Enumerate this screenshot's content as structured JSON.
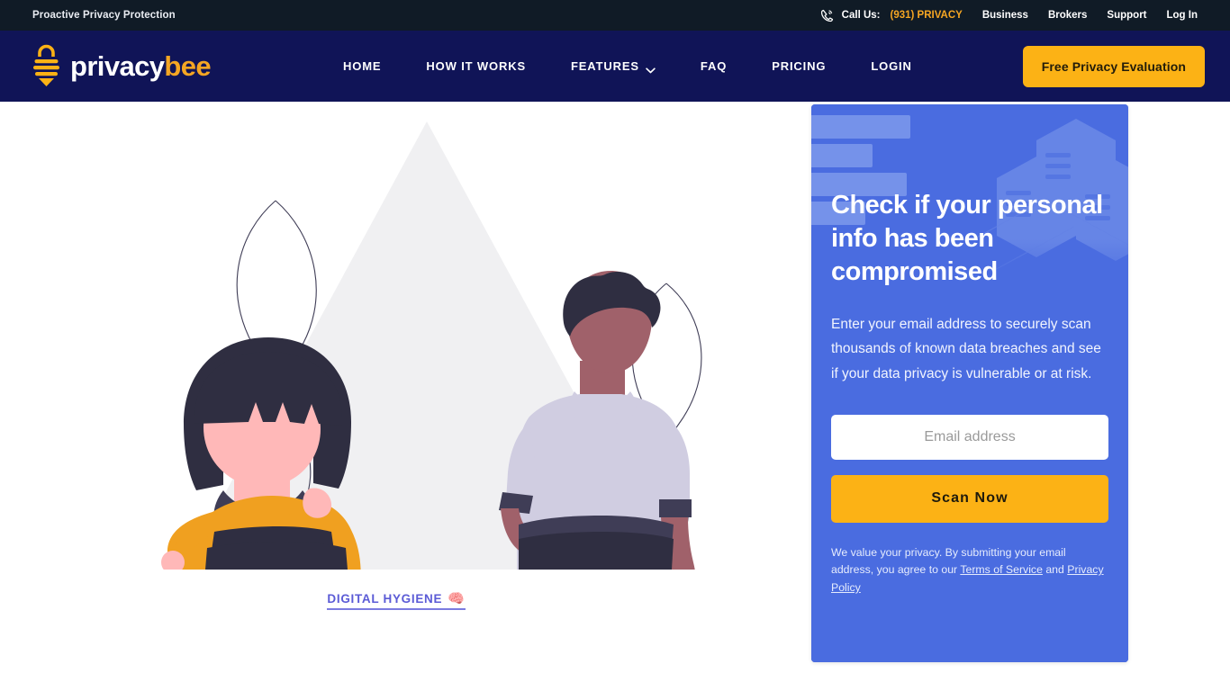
{
  "topbar": {
    "tagline": "Proactive Privacy Protection",
    "call_label": "Call Us:",
    "call_number": "(931) PRIVACY",
    "links": [
      {
        "label": "Business"
      },
      {
        "label": "Brokers"
      },
      {
        "label": "Support"
      },
      {
        "label": "Log In"
      }
    ]
  },
  "header": {
    "logo_primary": "privacy",
    "logo_accent": "bee",
    "nav": [
      {
        "label": "HOME",
        "has_caret": false
      },
      {
        "label": "HOW IT WORKS",
        "has_caret": false
      },
      {
        "label": "FEATURES",
        "has_caret": true
      },
      {
        "label": "FAQ",
        "has_caret": false
      },
      {
        "label": "PRICING",
        "has_caret": false
      },
      {
        "label": "LOGIN",
        "has_caret": false
      }
    ],
    "cta_label": "Free Privacy Evaluation"
  },
  "hero": {
    "hygiene_label": "DIGITAL HYGIENE",
    "hygiene_emoji": "🧠",
    "big_heading": ""
  },
  "scan_card": {
    "title": "Check if your personal info has been compromised",
    "subtitle": "Enter your email address to securely scan thousands of known data breaches and see if your data privacy is vulnerable or at risk.",
    "email_placeholder": "Email address",
    "email_value": "",
    "button_label": "Scan Now",
    "disclaimer_prefix": "We value your privacy. By submitting your email address, you agree to our ",
    "terms_link": "Terms of Service",
    "disclaimer_join": " and ",
    "privacy_link": "Privacy Policy"
  },
  "colors": {
    "topbar_bg": "#101b26",
    "header_bg": "#101457",
    "accent_yellow": "#fcb215",
    "card_blue": "#4a6ce0",
    "hygiene_purple": "#5b5bd6"
  }
}
